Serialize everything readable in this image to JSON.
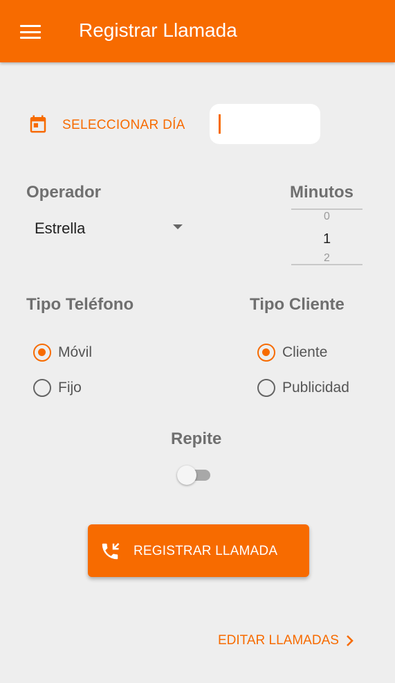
{
  "appbar": {
    "title": "Registrar Llamada",
    "menu_icon": "hamburger-menu-icon"
  },
  "date": {
    "select_label": "SELECCIONAR DÍA",
    "icon": "calendar-icon",
    "value": ""
  },
  "operator": {
    "label": "Operador",
    "selected": "Estrella"
  },
  "minutes": {
    "label": "Minutos",
    "prev": "0",
    "current": "1",
    "next": "2"
  },
  "phone_type": {
    "label": "Tipo Teléfono",
    "options": [
      {
        "label": "Móvil",
        "checked": true
      },
      {
        "label": "Fijo",
        "checked": false
      }
    ]
  },
  "client_type": {
    "label": "Tipo Cliente",
    "options": [
      {
        "label": "Cliente",
        "checked": true
      },
      {
        "label": "Publicidad",
        "checked": false
      }
    ]
  },
  "repeat": {
    "label": "Repite",
    "on": false
  },
  "actions": {
    "register_label": "REGISTRAR LLAMADA",
    "register_icon": "phone-callback-icon",
    "edit_label": "EDITAR LLAMADAS",
    "edit_icon": "chevron-right-icon"
  },
  "colors": {
    "accent": "#f76b00",
    "background": "#eeeeee",
    "label_gray": "#6f6f6f"
  }
}
